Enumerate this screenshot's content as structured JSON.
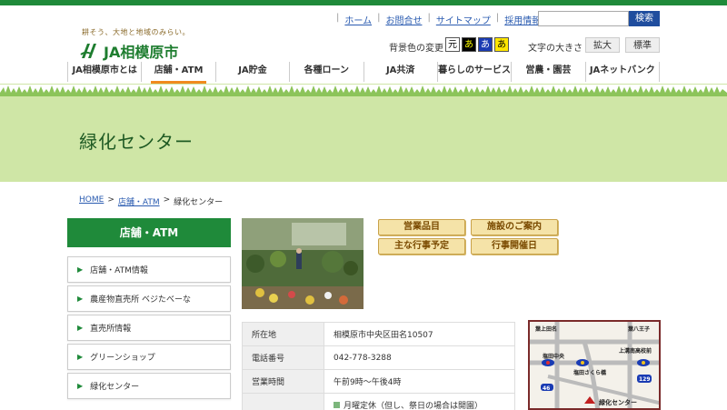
{
  "colors": {
    "brand_green": "#1f8a3a",
    "banner_green": "#cfe6a6",
    "accent_orange": "#f08a1e",
    "link_blue": "#2a5bb0"
  },
  "header": {
    "tagline": "耕そう、大地と地域のみらい。",
    "logo_text": "JA相模原市",
    "util_links": [
      "ホーム",
      "お問合せ",
      "サイトマップ",
      "採用情報"
    ],
    "search_button": "検索",
    "search_placeholder": "",
    "bg_color_label": "背景色の変更",
    "bg_swatches": [
      "元",
      "あ",
      "あ",
      "あ"
    ],
    "font_size_label": "文字の大きさ",
    "font_enlarge": "拡大",
    "font_standard": "標準"
  },
  "nav": {
    "items": [
      "JA相模原市とは",
      "店舗・ATM",
      "JA貯金",
      "各種ローン",
      "JA共済",
      "暮らしのサービス",
      "営農・園芸",
      "JAネットバンク"
    ],
    "active_index": 1
  },
  "banner": {
    "title": "緑化センター"
  },
  "breadcrumb": {
    "home": "HOME",
    "sep": ">",
    "parent": "店舗・ATM",
    "current": "緑化センター"
  },
  "sidebar": {
    "heading": "店舗・ATM",
    "items": [
      "店舗・ATM情報",
      "農産物直売所 ベジたべーな",
      "直売所情報",
      "グリーンショップ",
      "緑化センター"
    ]
  },
  "buttons": {
    "items": "営業品目",
    "facility": "施設のご案内",
    "events": "主な行事予定",
    "event_days": "行事開催日"
  },
  "info": {
    "rows": [
      {
        "key": "所在地",
        "value": "相模原市中央区田名10507"
      },
      {
        "key": "電話番号",
        "value": "042-778-3288"
      },
      {
        "key": "営業時間",
        "value": "午前9時～午後4時"
      },
      {
        "key": "",
        "value": "月曜定休（但し、祭日の場合は開園）"
      }
    ]
  },
  "map": {
    "labels": [
      "葉上田名",
      "葉八王子",
      "塩田中央",
      "上溝南高校前",
      "塩田さくら橋",
      "緑化センター"
    ],
    "route_numbers": [
      "46",
      "129"
    ]
  }
}
